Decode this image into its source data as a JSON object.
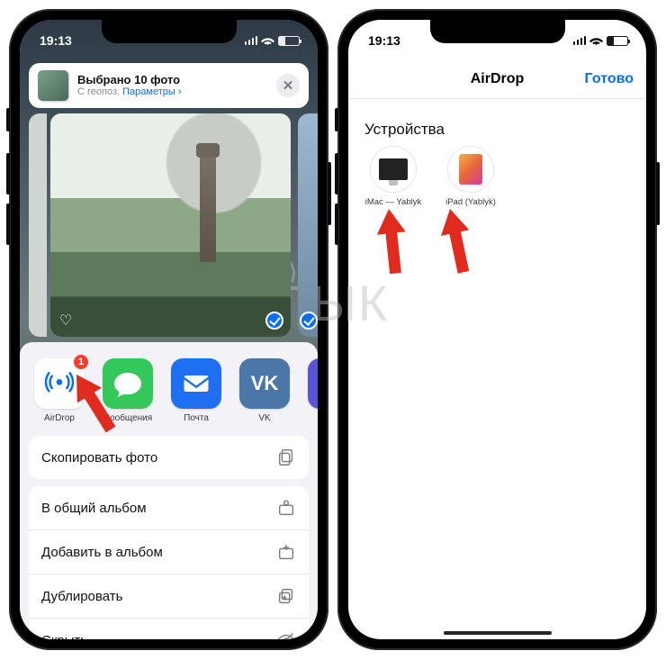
{
  "status": {
    "time": "19:13"
  },
  "watermark": "ЫК",
  "left": {
    "share_header": {
      "title": "Выбрано 10 фото",
      "subtitle_prefix": "С геопоз.",
      "options_link": "Параметры",
      "chevron": "›"
    },
    "apps": {
      "airdrop": {
        "label": "AirDrop",
        "badge": "1"
      },
      "messages": {
        "label": "Сообщения"
      },
      "mail": {
        "label": "Почта"
      },
      "vk": {
        "label": "VK",
        "glyph": "VK"
      },
      "close_glyph": "✕"
    },
    "actions_group1": [
      {
        "label": "Скопировать фото"
      }
    ],
    "actions_group2": [
      {
        "label": "В общий альбом"
      },
      {
        "label": "Добавить в альбом"
      },
      {
        "label": "Дублировать"
      },
      {
        "label": "Скрыть"
      }
    ]
  },
  "right": {
    "nav_title": "AirDrop",
    "done": "Готово",
    "section": "Устройства",
    "devices": [
      {
        "label": "iMac — Yablyk"
      },
      {
        "label": "iPad (Yablyk)"
      }
    ]
  }
}
